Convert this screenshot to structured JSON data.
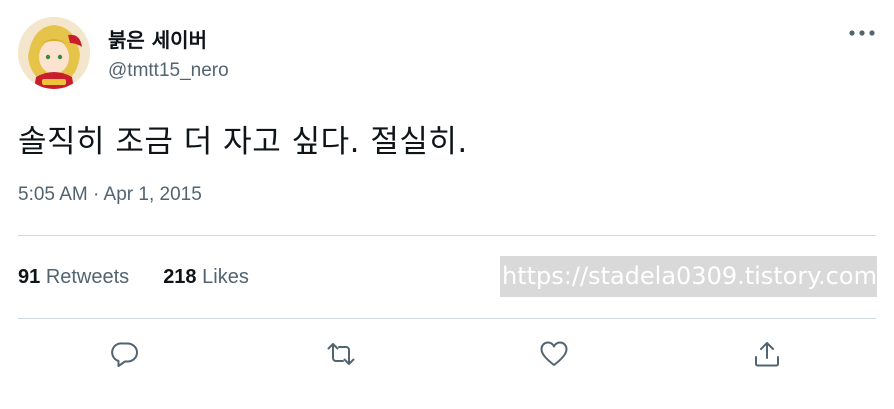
{
  "user": {
    "display_name": "붉은 세이버",
    "handle": "@tmtt15_nero",
    "avatar_icon": "avatar-image"
  },
  "tweet": {
    "text": "솔직히 조금 더 자고 싶다. 절실히.",
    "timestamp": "5:05 AM · Apr 1, 2015"
  },
  "stats": {
    "retweets_count": "91",
    "retweets_label": "Retweets",
    "likes_count": "218",
    "likes_label": "Likes"
  },
  "watermark": "https://stadela0309.tistory.com",
  "actions": {
    "reply_icon": "reply-icon",
    "retweet_icon": "retweet-icon",
    "like_icon": "heart-icon",
    "share_icon": "share-icon"
  },
  "colors": {
    "text_primary": "#0f1419",
    "text_secondary": "#536471",
    "divider": "#cfd9de"
  }
}
